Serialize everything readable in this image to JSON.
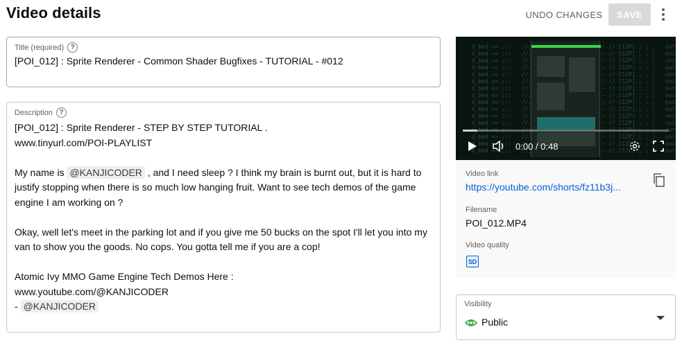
{
  "header": {
    "title": "Video details",
    "undo_label": "UNDO CHANGES",
    "save_label": "SAVE"
  },
  "title_field": {
    "label": "Title (required)",
    "value": "[POI_012] : Sprite Renderer - Common Shader Bugfixes - TUTORIAL - #012"
  },
  "description_field": {
    "label": "Description",
    "line1": "[POI_012] : Sprite Renderer - STEP BY STEP TUTORIAL .",
    "line2": "www.tinyurl.com/POI-PLAYLIST",
    "line4_before": "My name is ",
    "mention": "@KANJICODER",
    "line4_after": " , and I need sleep ? I think my brain is burnt out, but it is hard to",
    "line5": "justify stopping when there is so much  low hanging fruit. Want to see tech demos of the game",
    "line6": "engine I am working on ?",
    "line8": "Okay, well let's meet in the parking lot and if you give me 50 bucks on the spot I'll let you into my",
    "line9": "van to show you the goods. No cops. You gotta tell me if you are a cop!",
    "line11": "Atomic Ivy MMO Game Engine Tech Demos Here :",
    "line12": "www.youtube.com/@KANJICODER",
    "line13_prefix": "- "
  },
  "video_card": {
    "time": "0:00 / 0:48",
    "progress": 0.07,
    "link_label": "Video link",
    "link": "https://youtube.com/shorts/fz11b3j...",
    "filename_label": "Filename",
    "filename": "POI_012.MP4",
    "quality_label": "Video quality",
    "quality_badge": "SD"
  },
  "visibility": {
    "label": "Visibility",
    "value": "Public"
  },
  "colors": {
    "link": "#065fd4",
    "visibility_icon": "#2ba640"
  },
  "icons": {
    "help": "help-circle-icon",
    "more": "more-vert-icon",
    "play": "play-icon",
    "volume": "volume-icon",
    "settings": "gear-icon",
    "fullscreen": "fullscreen-icon",
    "copy": "copy-icon",
    "visibility": "eye-icon",
    "dropdown": "caret-down-icon"
  }
}
